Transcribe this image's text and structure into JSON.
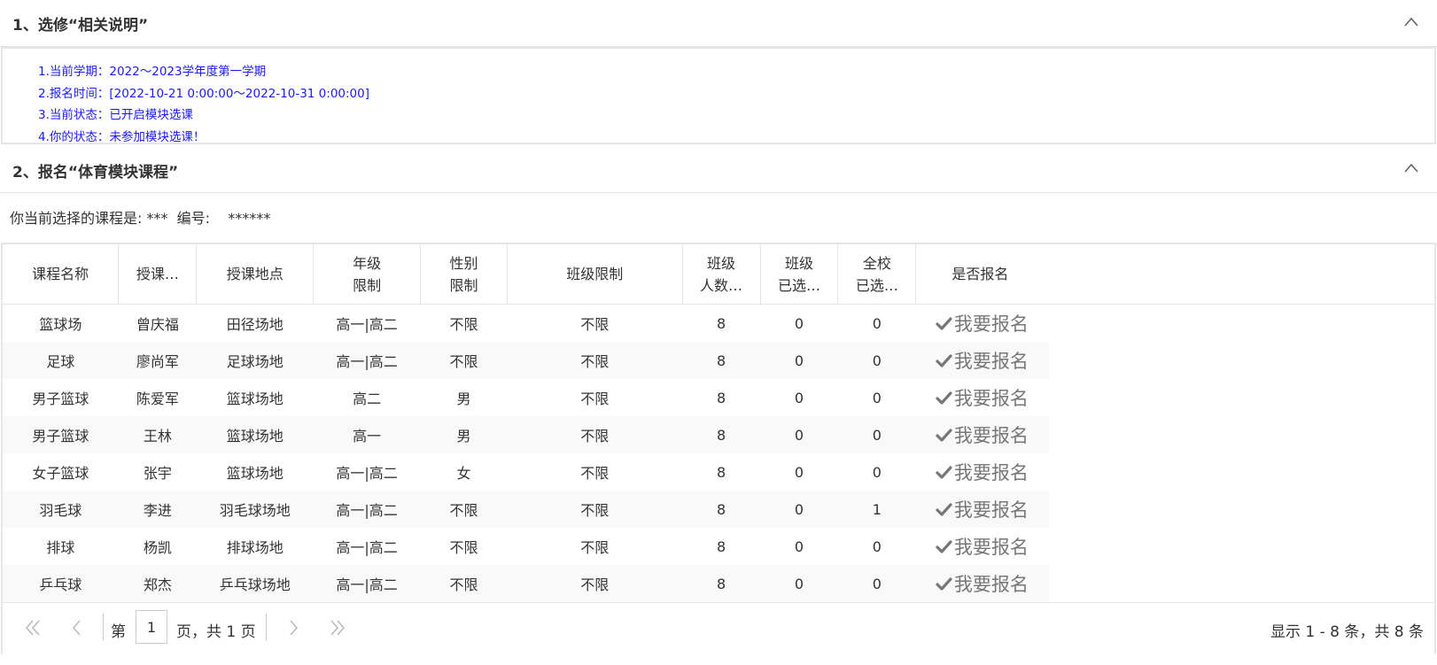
{
  "section1": {
    "title": "1、选修“相关说明”"
  },
  "info": [
    "1.当前学期：2022～2023学年度第一学期",
    "2.报名时间：[2022-10-21 0:00:00～2022-10-31 0:00:00]",
    "3.当前状态：已开启模块选课",
    "4.你的状态：未参加模块选课！"
  ],
  "section2": {
    "title": "2、报名“体育模块课程”"
  },
  "current": {
    "label": "你当前选择的课程是: ",
    "course": "***",
    "code_label": "  编号:  ",
    "code": "  ******"
  },
  "table": {
    "headers": [
      [
        "课程名称"
      ],
      [
        "授课…"
      ],
      [
        "授课地点"
      ],
      [
        "年级",
        "限制"
      ],
      [
        "性别",
        "限制"
      ],
      [
        "班级限制"
      ],
      [
        "班级",
        "人数…"
      ],
      [
        "班级",
        "已选…"
      ],
      [
        "全校",
        "已选…"
      ],
      [
        "是否报名"
      ]
    ],
    "rows": [
      [
        "篮球场",
        "曾庆福",
        "田径场地",
        "高一|高二",
        "不限",
        "不限",
        "8",
        "0",
        "0"
      ],
      [
        "足球",
        "廖尚军",
        "足球场地",
        "高一|高二",
        "不限",
        "不限",
        "8",
        "0",
        "0"
      ],
      [
        "男子篮球",
        "陈爱军",
        "篮球场地",
        "高二",
        "男",
        "不限",
        "8",
        "0",
        "0"
      ],
      [
        "男子篮球",
        "王林",
        "篮球场地",
        "高一",
        "男",
        "不限",
        "8",
        "0",
        "0"
      ],
      [
        "女子篮球",
        "张宇",
        "篮球场地",
        "高一|高二",
        "女",
        "不限",
        "8",
        "0",
        "0"
      ],
      [
        "羽毛球",
        "李进",
        "羽毛球场地",
        "高一|高二",
        "不限",
        "不限",
        "8",
        "0",
        "1"
      ],
      [
        "排球",
        "杨凯",
        "排球场地",
        "高一|高二",
        "不限",
        "不限",
        "8",
        "0",
        "0"
      ],
      [
        "乒乓球",
        "郑杰",
        "乒乓球场地",
        "高一|高二",
        "不限",
        "不限",
        "8",
        "0",
        "0"
      ]
    ],
    "signup_label": "我要报名"
  },
  "pager": {
    "prefix": "第",
    "page_value": "1",
    "suffix": "页，共 1 页",
    "summary": "显示 1 - 8 条，共 8 条"
  },
  "colors": {
    "info_text": "#1a1aff",
    "border": "#e6e6e6",
    "signup": "#777777"
  },
  "icons": [
    "chevron-up-icon",
    "check-icon",
    "first-page-icon",
    "prev-page-icon",
    "next-page-icon",
    "last-page-icon"
  ]
}
